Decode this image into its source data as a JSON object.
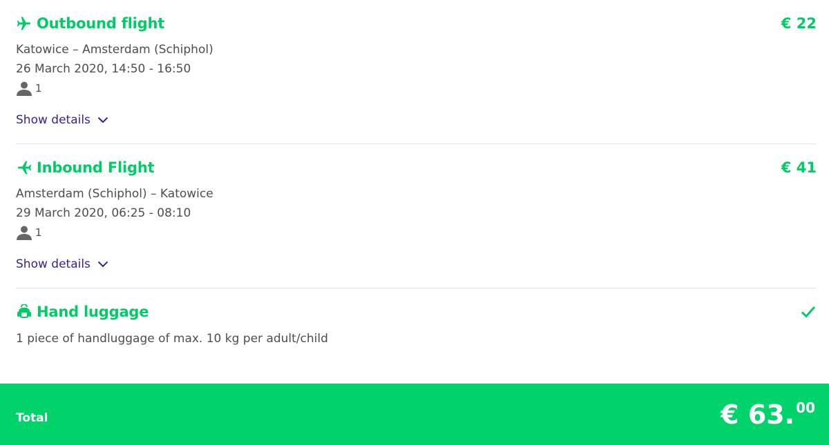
{
  "outbound": {
    "title": "Outbound flight",
    "price": "€ 22",
    "route": "Katowice – Amsterdam (Schiphol)",
    "datetime": "26 March 2020, 14:50 - 16:50",
    "passengers": "1",
    "details_label": "Show details",
    "icon": "plane-right-icon"
  },
  "inbound": {
    "title": "Inbound Flight",
    "price": "€ 41",
    "route": "Amsterdam (Schiphol) – Katowice",
    "datetime": "29 March 2020, 06:25 - 08:10",
    "passengers": "1",
    "details_label": "Show details",
    "icon": "plane-left-icon"
  },
  "luggage": {
    "title": "Hand luggage",
    "description": "1 piece of handluggage of max. 10 kg per adult/child",
    "icon": "backpack-icon",
    "status_icon": "check-icon"
  },
  "total": {
    "label": "Total",
    "amount_main": "€ 63.",
    "amount_cents": "00"
  },
  "colors": {
    "accent_green": "#00cc66",
    "total_bar": "#00d36a",
    "link_purple": "#3a1d8e",
    "text": "#4d4d4d"
  }
}
